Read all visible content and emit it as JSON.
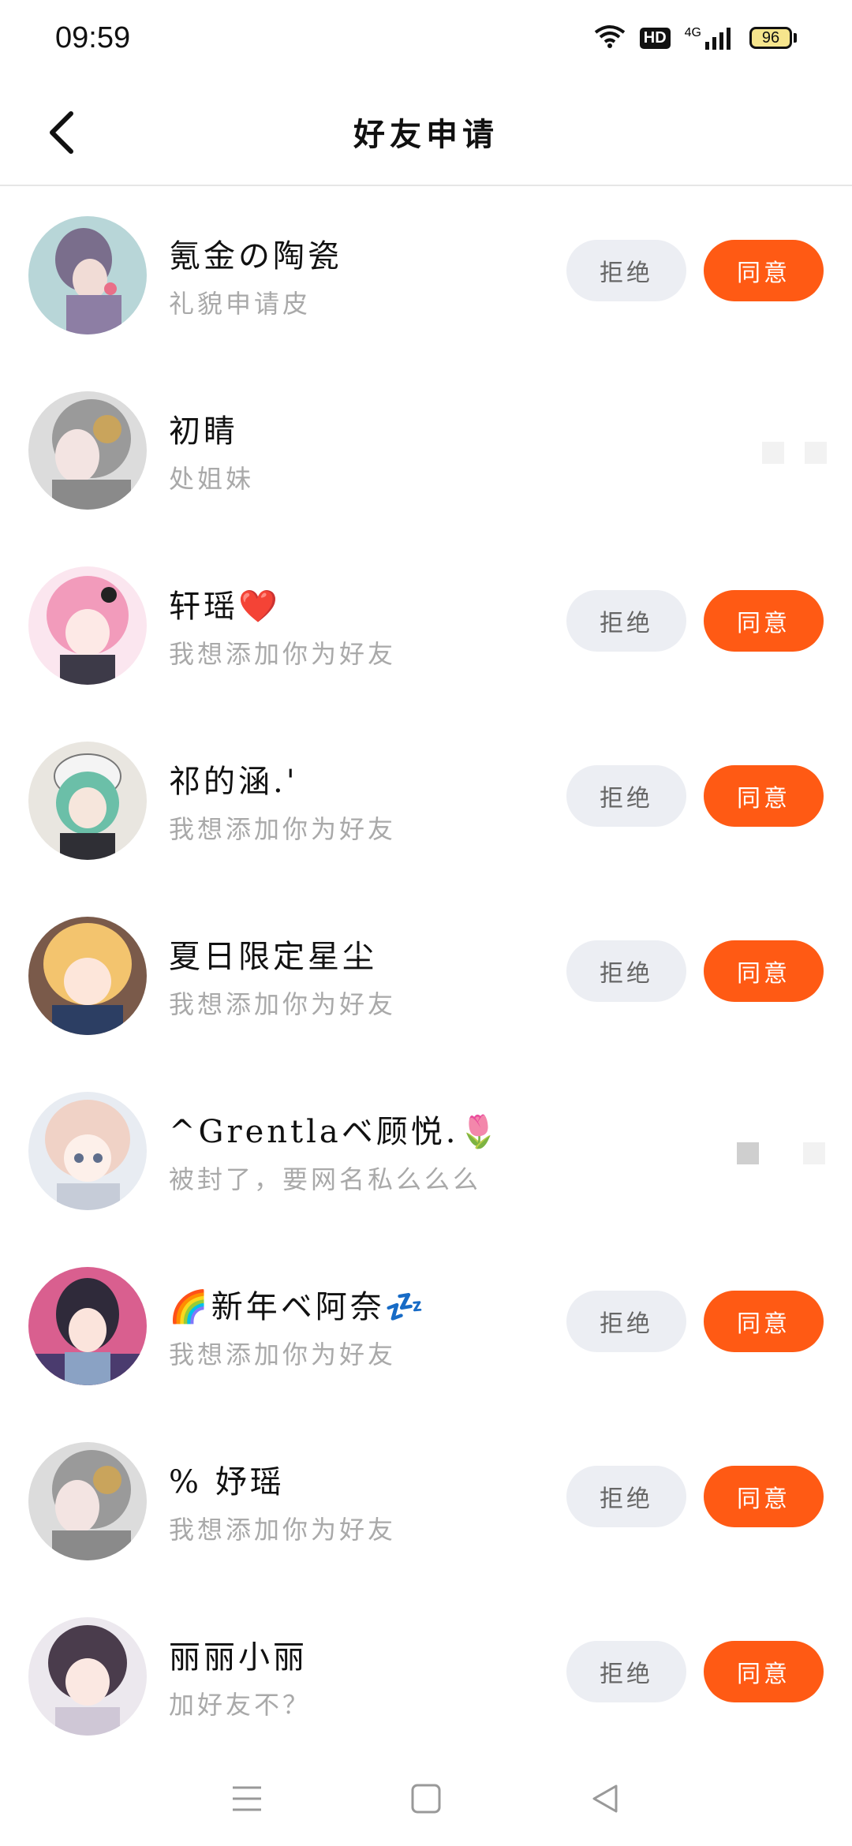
{
  "status_bar": {
    "time": "09:59",
    "hd": "HD",
    "network": "4G",
    "battery": "96"
  },
  "header": {
    "title": "好友申请"
  },
  "actions": {
    "reject_label": "拒绝",
    "accept_label": "同意"
  },
  "requests": [
    {
      "name": "氪金の陶瓷",
      "message": "礼貌申请皮",
      "has_actions": true
    },
    {
      "name": "初睛",
      "message": "处姐妹",
      "has_actions": false
    },
    {
      "name": "轩瑶❤️",
      "message": "我想添加你为好友",
      "has_actions": true
    },
    {
      "name": "祁的涵.'",
      "message": "我想添加你为好友",
      "has_actions": true
    },
    {
      "name": "夏日限定星尘",
      "message": "我想添加你为好友",
      "has_actions": true
    },
    {
      "name": "^Grentlaベ顾悦.🌷",
      "message": "被封了，要网名私么么么",
      "has_actions": false
    },
    {
      "name": "🌈新年ベ阿奈💤",
      "message": "我想添加你为好友",
      "has_actions": true
    },
    {
      "name": "% 妤瑶",
      "message": "我想添加你为好友",
      "has_actions": true
    },
    {
      "name": "丽丽小丽",
      "message": "加好友不？",
      "has_actions": true
    }
  ],
  "colors": {
    "accept": "#ff5a14",
    "reject_bg": "#eceef3",
    "divider": "#e6e6e6"
  }
}
